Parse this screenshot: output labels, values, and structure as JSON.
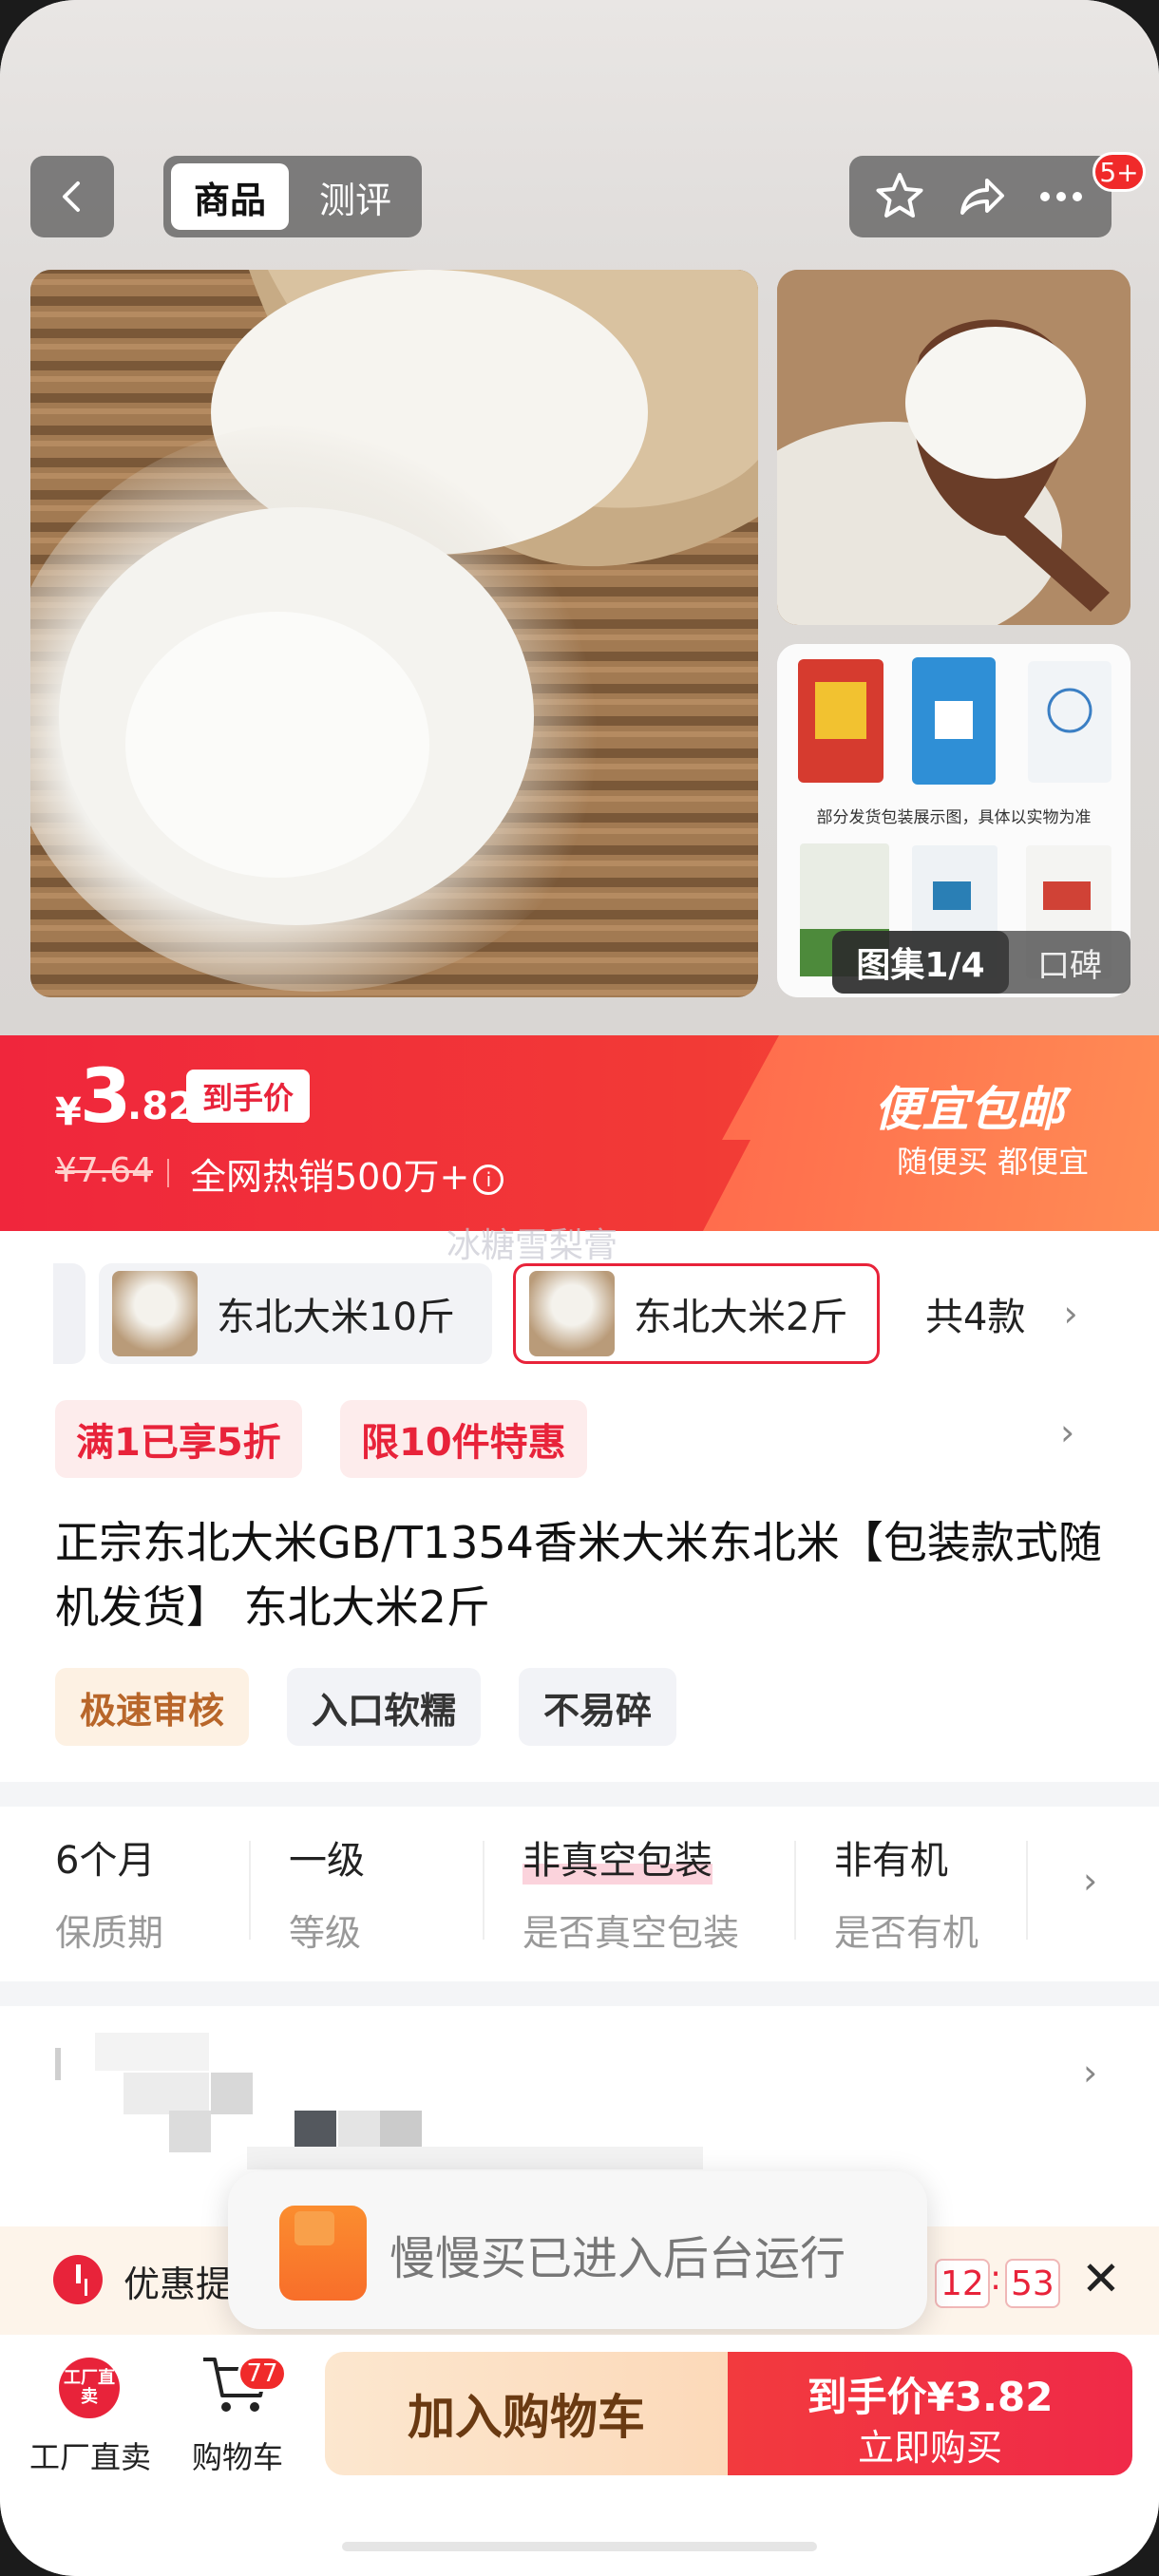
{
  "topbar": {
    "tab_product": "商品",
    "tab_review": "测评",
    "more_badge": "5+"
  },
  "gallery": {
    "counter_label": "图集1/4",
    "reviews_label": "口碑",
    "packaging_caption": "部分发货包装展示图，具体以实物为准"
  },
  "price": {
    "currency": "¥",
    "integer": "3",
    "decimal": ".82",
    "tag": "到手价",
    "original": "¥7.64",
    "hot_sales": "全网热销500万+",
    "promo_title": "便宜包邮",
    "promo_sub": "随便买 都便宜",
    "watermark": "冰糖雪梨膏"
  },
  "variants": {
    "items": [
      {
        "label": "东北大米10斤"
      },
      {
        "label": "东北大米2斤"
      }
    ],
    "more": "共4款"
  },
  "chips": [
    "满1已享5折",
    "限10件特惠"
  ],
  "product_title": "正宗东北大米GB/T1354香米大米东北米【包装款式随机发货】 东北大米2斤",
  "tags": [
    "极速审核",
    "入口软糯",
    "不易碎"
  ],
  "attributes": [
    {
      "value": "6个月",
      "key": "保质期"
    },
    {
      "value": "一级",
      "key": "等级"
    },
    {
      "value": "非真空包装",
      "key": "是否真空包装"
    },
    {
      "value": "非有机",
      "key": "是否有机"
    }
  ],
  "notice": {
    "label": "优惠提",
    "timer_min": "12",
    "timer_sep": ":",
    "timer_sec": "53"
  },
  "toast": {
    "message": "慢慢买已进入后台运行"
  },
  "bottombar": {
    "factory_icon": "工厂直卖",
    "factory_label": "工厂直卖",
    "cart_label": "购物车",
    "cart_badge": "77",
    "add_to_cart": "加入购物车",
    "buy_price": "到手价¥3.82",
    "buy_now": "立即购买"
  },
  "colors": {
    "accent": "#e8233a",
    "promo_orange": "#ff8c55",
    "add_cart_bg": "#fcd9b9"
  }
}
